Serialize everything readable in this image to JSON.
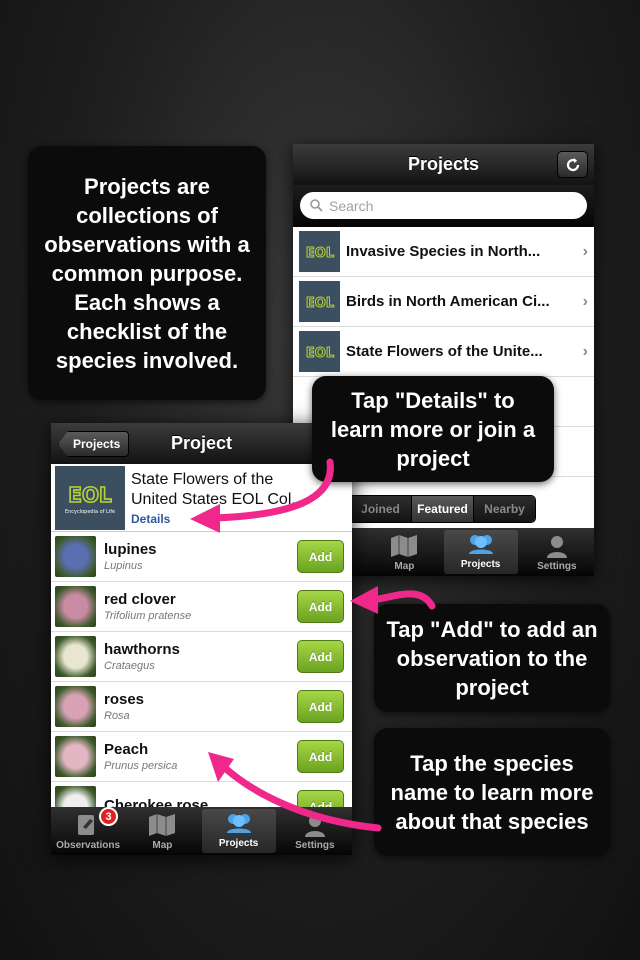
{
  "callouts": {
    "projects": "Projects are collections of observations with a common purpose. Each shows a checklist of the species involved.",
    "details": "Tap \"Details\" to learn more or join a project",
    "add": "Tap \"Add\" to add an observation to the project",
    "species": "Tap the species name to learn more about that species"
  },
  "back_screen": {
    "title": "Projects",
    "search_placeholder": "Search",
    "projects": [
      {
        "name": "Invasive Species in North..."
      },
      {
        "name": "Birds in North American Ci..."
      },
      {
        "name": "State Flowers of the Unite..."
      }
    ],
    "segments": [
      "Joined",
      "Featured",
      "Nearby"
    ],
    "active_segment": "Featured",
    "tabs": [
      "ns",
      "Map",
      "Projects",
      "Settings"
    ]
  },
  "front_screen": {
    "back_label": "Projects",
    "title": "Project",
    "project_title_line1": "State Flowers of the",
    "project_title_line2": "United States  EOL Col...",
    "details_label": "Details",
    "add_label": "Add",
    "species": [
      {
        "common": "lupines",
        "scientific": "Lupinus",
        "color": "#5a6fb0"
      },
      {
        "common": "red clover",
        "scientific": "Trifolium pratense",
        "color": "#c98aa4"
      },
      {
        "common": "hawthorns",
        "scientific": "Crataegus",
        "color": "#e8e6d0"
      },
      {
        "common": "roses",
        "scientific": "Rosa",
        "color": "#d7a3b4"
      },
      {
        "common": "Peach",
        "scientific": "Prunus persica",
        "color": "#e2b7c3"
      },
      {
        "common": "Cherokee rose",
        "scientific": "",
        "color": "#eeeeee"
      }
    ],
    "tabs": [
      "Observations",
      "Map",
      "Projects",
      "Settings"
    ],
    "badge_count": "3"
  },
  "logo_text": "EOL",
  "logo_subtext": "Encyclopedia of Life",
  "colors": {
    "accent_arrow": "#f0288c",
    "add_green": "#7fb72d",
    "eol_bg": "#3b4f60"
  }
}
